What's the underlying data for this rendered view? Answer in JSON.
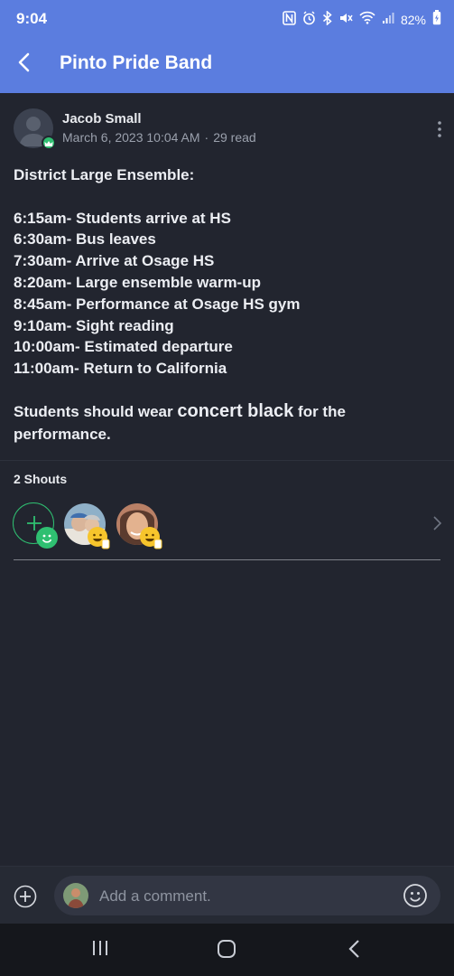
{
  "status_bar": {
    "time": "9:04",
    "battery": "82%",
    "icons": [
      "nfc-icon",
      "alarm-icon",
      "bluetooth-icon",
      "mute-icon",
      "wifi-icon",
      "signal-icon",
      "battery-icon"
    ]
  },
  "app_bar": {
    "title": "Pinto Pride Band",
    "back_icon": "chevron-left-icon",
    "background": "#5b7ddf"
  },
  "post": {
    "author": "Jacob Small",
    "date": "March 6, 2023 10:04 AM",
    "separator": "·",
    "read_count": "29 read",
    "heading": "District Large Ensemble:",
    "schedule": [
      "6:15am- Students arrive at HS",
      "6:30am- Bus leaves",
      "7:30am- Arrive at Osage HS",
      "8:20am- Large ensemble warm-up",
      "8:45am- Performance at Osage HS gym",
      "9:10am- Sight reading",
      "10:00am- Estimated departure",
      "11:00am- Return to California"
    ],
    "closing_pre": "Students should wear ",
    "closing_emphasis": "concert black",
    "closing_post": " for the performance."
  },
  "shouts": {
    "label": "2 Shouts"
  },
  "comment_bar": {
    "placeholder": "Add a comment."
  },
  "colors": {
    "accent_green": "#2fbf71",
    "background": "#22252f"
  }
}
